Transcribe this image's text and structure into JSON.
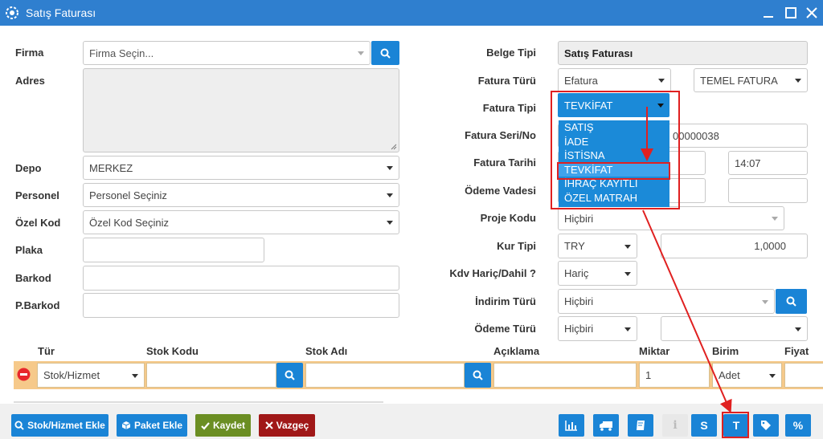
{
  "window": {
    "title": "Satış Faturası"
  },
  "left_form": {
    "firma": {
      "label": "Firma",
      "placeholder": "Firma Seçin..."
    },
    "adres": {
      "label": "Adres"
    },
    "depo": {
      "label": "Depo",
      "value": "MERKEZ"
    },
    "personel": {
      "label": "Personel",
      "value": "Personel Seçiniz"
    },
    "ozel_kod": {
      "label": "Özel Kod",
      "value": "Özel Kod Seçiniz"
    },
    "plaka": {
      "label": "Plaka",
      "value": ""
    },
    "barkod": {
      "label": "Barkod",
      "value": ""
    },
    "p_barkod": {
      "label": "P.Barkod",
      "value": ""
    }
  },
  "right_form": {
    "belge_tipi": {
      "label": "Belge Tipi",
      "value": "Satış Faturası"
    },
    "fatura_turu": {
      "label": "Fatura Türü",
      "value": "Efatura",
      "value2": "TEMEL FATURA"
    },
    "fatura_tipi": {
      "label": "Fatura Tipi",
      "value": "TEVKİFAT",
      "options": [
        "SATIŞ",
        "İADE",
        "İSTİSNA",
        "TEVKİFAT",
        "İHRAÇ KAYITLI",
        "ÖZEL MATRAH"
      ],
      "highlighted": "TEVKİFAT"
    },
    "fatura_seri_no": {
      "label": "Fatura Seri/No",
      "value": "00000038"
    },
    "fatura_tarihi": {
      "label": "Fatura Tarihi",
      "date": "",
      "time": "14:07"
    },
    "odeme_vadesi": {
      "label": "Ödeme Vadesi"
    },
    "proje_kodu": {
      "label": "Proje Kodu",
      "value": "Hiçbiri"
    },
    "kur_tipi": {
      "label": "Kur Tipi",
      "value": "TRY",
      "rate": "1,0000"
    },
    "kdv": {
      "label": "Kdv Hariç/Dahil ?",
      "value": "Hariç"
    },
    "indirim_turu": {
      "label": "İndirim Türü",
      "value": "Hiçbiri"
    },
    "odeme_turu": {
      "label": "Ödeme Türü",
      "value": "Hiçbiri",
      "value2": ""
    }
  },
  "grid": {
    "headers": [
      "Tür",
      "Stok Kodu",
      "Stok Adı",
      "Açıklama",
      "Miktar",
      "Birim",
      "Fiyat"
    ],
    "row": {
      "tur": "Stok/Hizmet",
      "stok_kodu": "",
      "stok_adi": "",
      "aciklama": "",
      "miktar": "1",
      "birim": "Adet"
    }
  },
  "footer": {
    "stok_hizmet_ekle": "Stok/Hizmet Ekle",
    "paket_ekle": "Paket Ekle",
    "kaydet": "Kaydet",
    "vazgec": "Vazgeç",
    "icon_buttons": [
      "chart-icon",
      "truck-icon",
      "book-icon",
      "info-icon",
      "S",
      "T",
      "tag-icon",
      "%"
    ]
  },
  "colors": {
    "titlebar": "#2f7fcf",
    "primary": "#1a84d6",
    "save": "#6b8e23",
    "cancel": "#a01818",
    "grid_row": "#f6c98a",
    "annotation": "#e02020"
  }
}
